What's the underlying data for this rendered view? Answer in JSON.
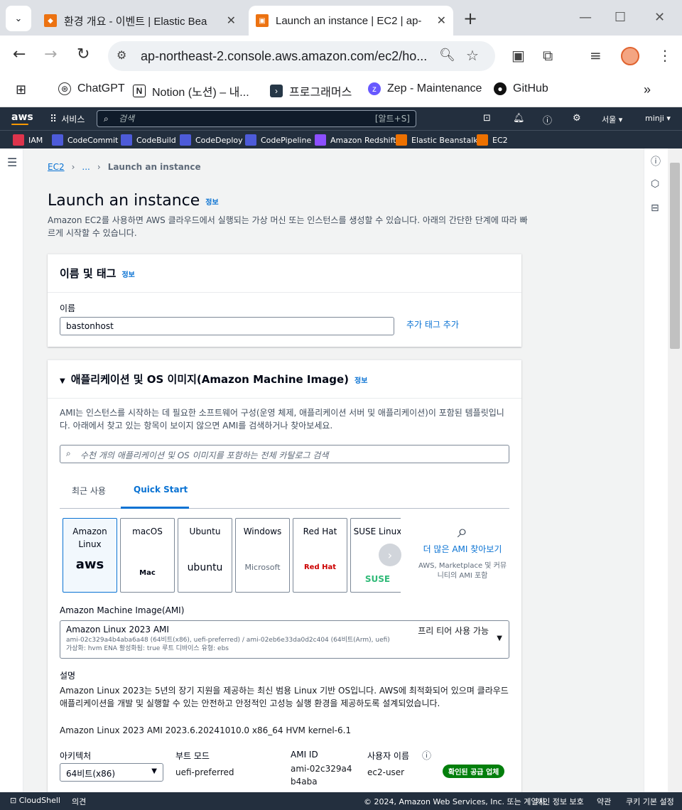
{
  "browser": {
    "tabs": [
      {
        "title": "환경 개요 - 이벤트 | Elastic Bea"
      },
      {
        "title": "Launch an instance | EC2 | ap-"
      }
    ],
    "url": "ap-northeast-2.console.aws.amazon.com/ec2/ho...",
    "bookmarks": [
      "ChatGPT",
      "Notion (노션) – 내...",
      "프로그래머스",
      "Zep - Maintenance",
      "GitHub"
    ]
  },
  "aws": {
    "logo": "aws",
    "services": "서비스",
    "search_placeholder": "검색",
    "search_shortcut": "[알트+S]",
    "region": "서울 ▾",
    "user": "minji ▾",
    "favorites": [
      "IAM",
      "CodeCommit",
      "CodeBuild",
      "CodeDeploy",
      "CodePipeline",
      "Amazon Redshift",
      "Elastic Beanstalk",
      "EC2"
    ]
  },
  "breadcrumb": {
    "root": "EC2",
    "middle": "...",
    "current": "Launch an instance"
  },
  "page": {
    "title": "Launch an instance",
    "info": "정보",
    "description": "Amazon EC2를 사용하면 AWS 클라우드에서 실행되는 가상 머신 또는 인스턴스를 생성할 수 있습니다. 아래의 간단한 단계에 따라 빠르게 시작할 수 있습니다."
  },
  "name_tags": {
    "header": "이름 및 태그",
    "info": "정보",
    "name_label": "이름",
    "name_value": "bastonhost",
    "add_tags": "추가 태그 추가"
  },
  "ami": {
    "header": "애플리케이션 및 OS 이미지(Amazon Machine Image)",
    "info": "정보",
    "description": "AMI는 인스턴스를 시작하는 데 필요한 소프트웨어 구성(운영 체제, 애플리케이션 서버 및 애플리케이션)이 포함된 템플릿입니다. 아래에서 찾고 있는 항목이 보이지 않으면 AMI를 검색하거나 찾아보세요.",
    "search_placeholder": "수천 개의 애플리케이션 및 OS 이미지를 포함하는 전체 카탈로그 검색",
    "tabs": [
      "최근 사용",
      "Quick Start"
    ],
    "os": [
      {
        "label": "Amazon Linux",
        "mark": "aws"
      },
      {
        "label": "macOS",
        "mark": "Mac"
      },
      {
        "label": "Ubuntu",
        "mark": "ubuntu"
      },
      {
        "label": "Windows",
        "mark": "Microsoft"
      },
      {
        "label": "Red Hat",
        "mark": "Red Hat"
      },
      {
        "label": "SUSE Linux",
        "mark": "SUSE"
      }
    ],
    "more_link": "더 많은 AMI 찾아보기",
    "more_desc": "AWS, Marketplace 및 커뮤니티의 AMI 포함",
    "ami_label": "Amazon Machine Image(AMI)",
    "selected": {
      "name": "Amazon Linux 2023 AMI",
      "free_tier": "프리 티어 사용 가능",
      "ids": "ami-02c329a4b4aba6a48 (64비트(x86), uefi-preferred) / ami-02eb6e33da0d2c404 (64비트(Arm), uefi)",
      "meta": "가상화: hvm    ENA 활성화됨: true    루트 디바이스 유형: ebs"
    },
    "desc_label": "설명",
    "desc_text": "Amazon Linux 2023는 5년의 장기 지원을 제공하는 최신 범용 Linux 기반 OS입니다. AWS에 최적화되어 있으며 클라우드 애플리케이션을 개발 및 실행할 수 있는 안전하고 안정적인 고성능 실행 환경을 제공하도록 설계되었습니다.",
    "version": "Amazon Linux 2023 AMI 2023.6.20241010.0 x86_64 HVM kernel-6.1",
    "arch_label": "아키텍처",
    "arch_value": "64비트(x86)",
    "boot_label": "부트 모드",
    "boot_value": "uefi-preferred",
    "amiid_label": "AMI ID",
    "amiid_value": "ami-02c329a4b4aba",
    "user_label": "사용자 이름",
    "user_value": "ec2-user",
    "verified": "확인된 공급 업체"
  },
  "footer": {
    "cloudshell": "CloudShell",
    "feedback": "의견",
    "copyright": "© 2024, Amazon Web Services, Inc. 또는 계열사.",
    "privacy": "개인 정보 보호",
    "terms": "약관",
    "cookies": "쿠키 기본 설정"
  }
}
